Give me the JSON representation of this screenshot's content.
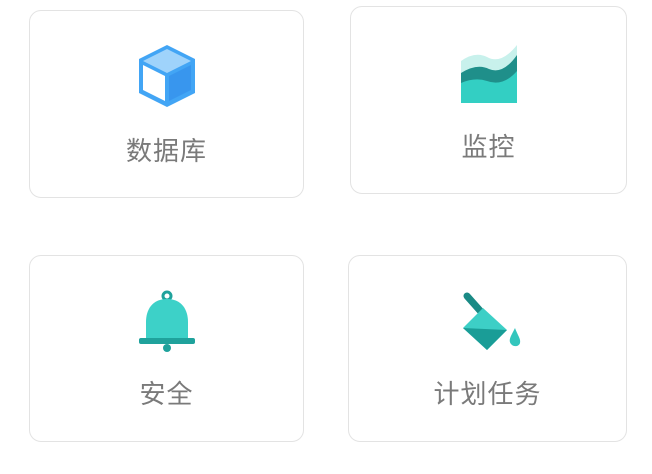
{
  "cards": [
    {
      "id": "database",
      "label": "数据库",
      "icon": "database-cube-icon",
      "color": "#42a5f5"
    },
    {
      "id": "monitor",
      "label": "监控",
      "icon": "monitor-chart-icon",
      "color": "#26c6b8"
    },
    {
      "id": "security",
      "label": "安全",
      "icon": "bell-icon",
      "color": "#2ec7c0"
    },
    {
      "id": "tasks",
      "label": "计划任务",
      "icon": "paint-bucket-icon",
      "color": "#1fa9a3"
    }
  ]
}
